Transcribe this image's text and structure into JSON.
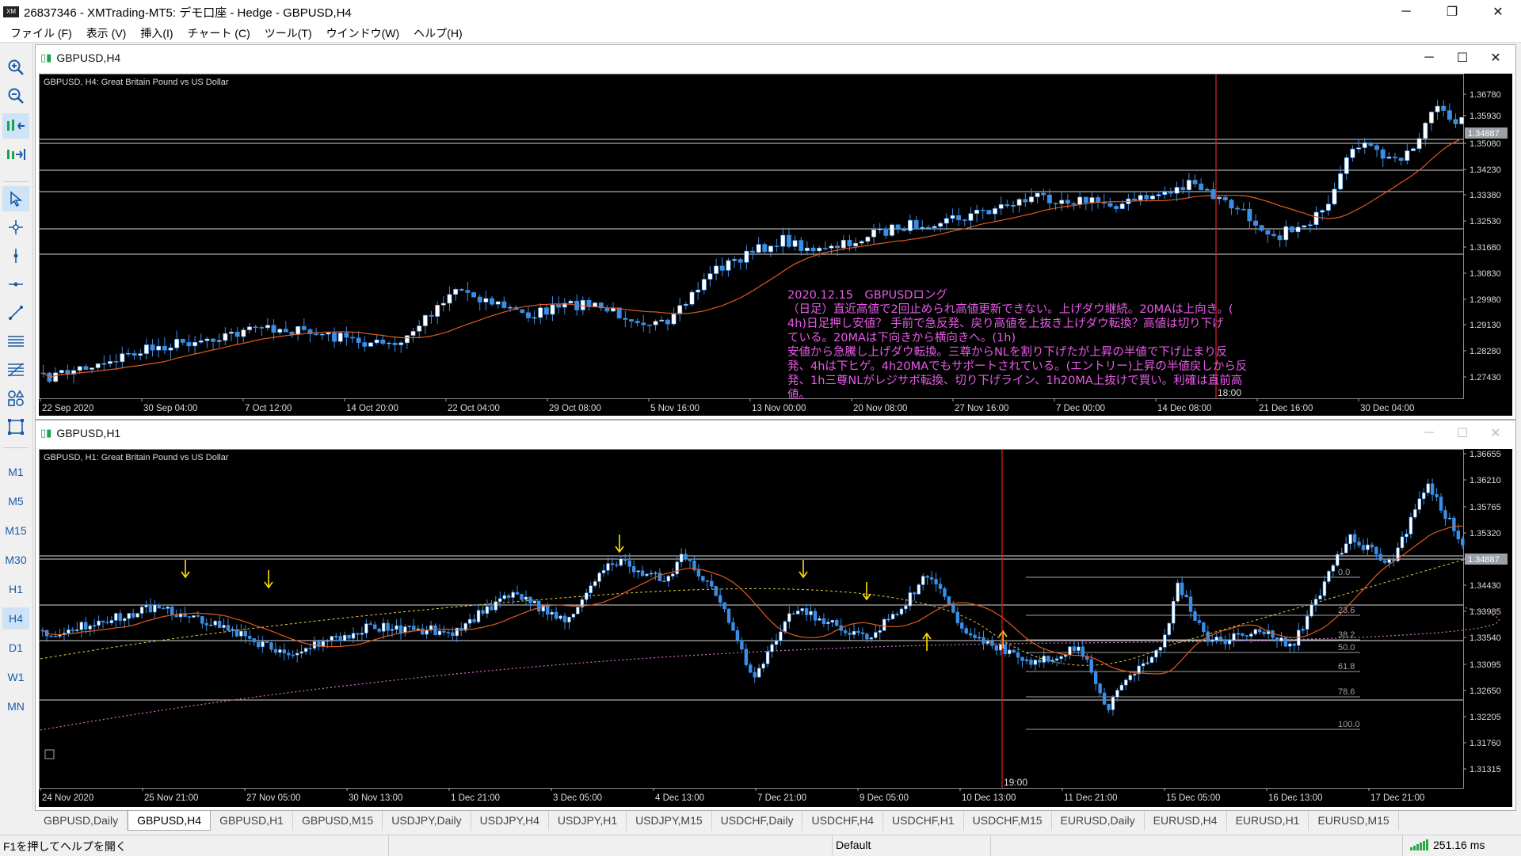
{
  "window": {
    "title": "26837346 - XMTrading-MT5: デモ口座 - Hedge - GBPUSD,H4",
    "minimize": "─",
    "restore": "❐",
    "close": "✕"
  },
  "menu": [
    "ファイル (F)",
    "表示 (V)",
    "挿入(I)",
    "チャート (C)",
    "ツール(T)",
    "ウインドウ(W)",
    "ヘルプ(H)"
  ],
  "timeframes": [
    "M1",
    "M5",
    "M15",
    "M30",
    "H1",
    "H4",
    "D1",
    "W1",
    "MN"
  ],
  "active_timeframe": "H4",
  "tool_icons": [
    "zoom-in-icon",
    "zoom-out-icon",
    "chart-shift-icon",
    "auto-scroll-icon",
    "cursor-icon",
    "crosshair-icon",
    "vertical-line-icon",
    "horizontal-line-icon",
    "trendline-icon",
    "channel-icon",
    "fibonacci-icon",
    "shapes-icon",
    "object-icon"
  ],
  "chart_top": {
    "window_title": "GBPUSD,H4",
    "label": "GBPUSD, H4:  Great Britain Pound vs US Dollar",
    "y_ticks": [
      "1.36780",
      "1.35930",
      "1.35080",
      "1.34230",
      "1.33380",
      "1.32530",
      "1.31680",
      "1.30830",
      "1.29980",
      "1.29130",
      "1.28280",
      "1.27430"
    ],
    "x_ticks": [
      "22 Sep 2020",
      "30 Sep 04:00",
      "7 Oct 12:00",
      "14 Oct 20:00",
      "22 Oct 04:00",
      "29 Oct 08:00",
      "5 Nov 16:00",
      "13 Nov 00:00",
      "20 Nov 08:00",
      "27 Nov 16:00",
      "7 Dec 00:00",
      "14 Dec 08:00",
      "21 Dec 16:00",
      "30 Dec 04:00"
    ],
    "current_price": "1.34887",
    "cursor_time": "18:00",
    "note_lines": [
      "2020.12.15　GBPUSDロング",
      "（日足）直近高値で2回止められ高値更新できない。上げダウ継続。20MAは上向き。(",
      "4h)日足押し安値？ 手前で急反発、戻り高値を上抜き上げダウ転換？高値は切り下げ",
      "ている。20MAは下向きから横向きへ。(1h)",
      "安値から急騰し上げダウ転換。三尊からNLを割り下げたが上昇の半値で下げ止まり反",
      "発、4hは下ヒゲ。4h20MAでもサポートされている。(エントリー)上昇の半値戻しから反",
      "発、1h三尊NLがレジサポ転換、切り下げライン、1h20MA上抜けで買い。利確は直前高",
      "値。"
    ]
  },
  "chart_bottom": {
    "window_title": "GBPUSD,H1",
    "label": "GBPUSD, H1:  Great Britain Pound vs US Dollar",
    "y_ticks": [
      "1.36655",
      "1.36210",
      "1.35765",
      "1.35320",
      "1.34875",
      "1.34430",
      "1.33985",
      "1.33540",
      "1.33095",
      "1.32650",
      "1.32205",
      "1.31760",
      "1.31315"
    ],
    "x_ticks": [
      "24 Nov 2020",
      "25 Nov 21:00",
      "27 Nov 05:00",
      "30 Nov 13:00",
      "1 Dec 21:00",
      "3 Dec 05:00",
      "4 Dec 13:00",
      "7 Dec 21:00",
      "9 Dec 05:00",
      "10 Dec 13:00",
      "11 Dec 21:00",
      "15 Dec 05:00",
      "16 Dec 13:00",
      "17 Dec 21:00"
    ],
    "current_price": "1.34887",
    "cursor_time": "19:00",
    "fib_levels": [
      "0.0",
      "23.6",
      "38.2",
      "50.0",
      "61.8",
      "78.6",
      "100.0"
    ]
  },
  "tabs": [
    "GBPUSD,Daily",
    "GBPUSD,H4",
    "GBPUSD,H1",
    "GBPUSD,M15",
    "USDJPY,Daily",
    "USDJPY,H4",
    "USDJPY,H1",
    "USDJPY,M15",
    "USDCHF,Daily",
    "USDCHF,H4",
    "USDCHF,H1",
    "USDCHF,M15",
    "EURUSD,Daily",
    "EURUSD,H4",
    "EURUSD,H1",
    "EURUSD,M15"
  ],
  "active_tab": "GBPUSD,H4",
  "status": {
    "help": "F1を押してヘルプを開く",
    "profile": "Default",
    "ping": "251.16 ms"
  },
  "colors": {
    "candle": "#3a8ee6",
    "ma": "#e05a1e",
    "note_text": "#e85be8",
    "cursor_line": "#e02020",
    "arrow": "#ffe000",
    "fib": "#a0a0a0"
  }
}
